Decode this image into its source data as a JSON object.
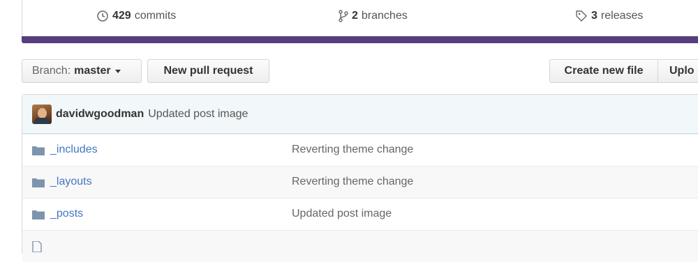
{
  "summary": {
    "commits": {
      "count": "429",
      "label": "commits"
    },
    "branches": {
      "count": "2",
      "label": "branches"
    },
    "releases": {
      "count": "3",
      "label": "releases"
    }
  },
  "language_bar": {
    "color": "#563d7c"
  },
  "toolbar": {
    "branch_label": "Branch:",
    "branch_value": "master",
    "new_pr_label": "New pull request",
    "create_file_label": "Create new file",
    "upload_label": "Uplo"
  },
  "latest_commit": {
    "author": "davidwgoodman",
    "message": "Updated post image"
  },
  "files": [
    {
      "name": "_includes",
      "message": "Reverting theme change",
      "icon": "folder-icon"
    },
    {
      "name": "_layouts",
      "message": "Reverting theme change",
      "icon": "folder-icon"
    },
    {
      "name": "_posts",
      "message": "Updated post image",
      "icon": "folder-icon"
    },
    {
      "name": "",
      "message": "",
      "icon": "file-icon"
    }
  ]
}
